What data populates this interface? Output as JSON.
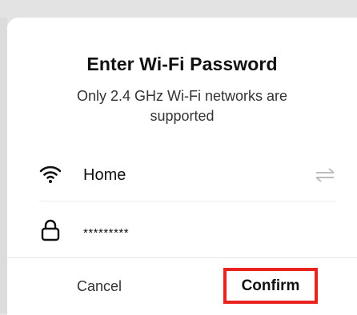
{
  "dialog": {
    "title": "Enter Wi-Fi Password",
    "subtitle": "Only 2.4 GHz Wi-Fi networks are supported",
    "network": {
      "icon": "wifi-icon",
      "name": "Home",
      "switch_icon": "switch-network-icon"
    },
    "password": {
      "icon": "lock-icon",
      "value": "*********"
    },
    "buttons": {
      "cancel_label": "Cancel",
      "confirm_label": "Confirm"
    }
  },
  "colors": {
    "highlight": "#e8231e",
    "text_primary": "#111111",
    "icon_muted": "#bdbdbd"
  }
}
